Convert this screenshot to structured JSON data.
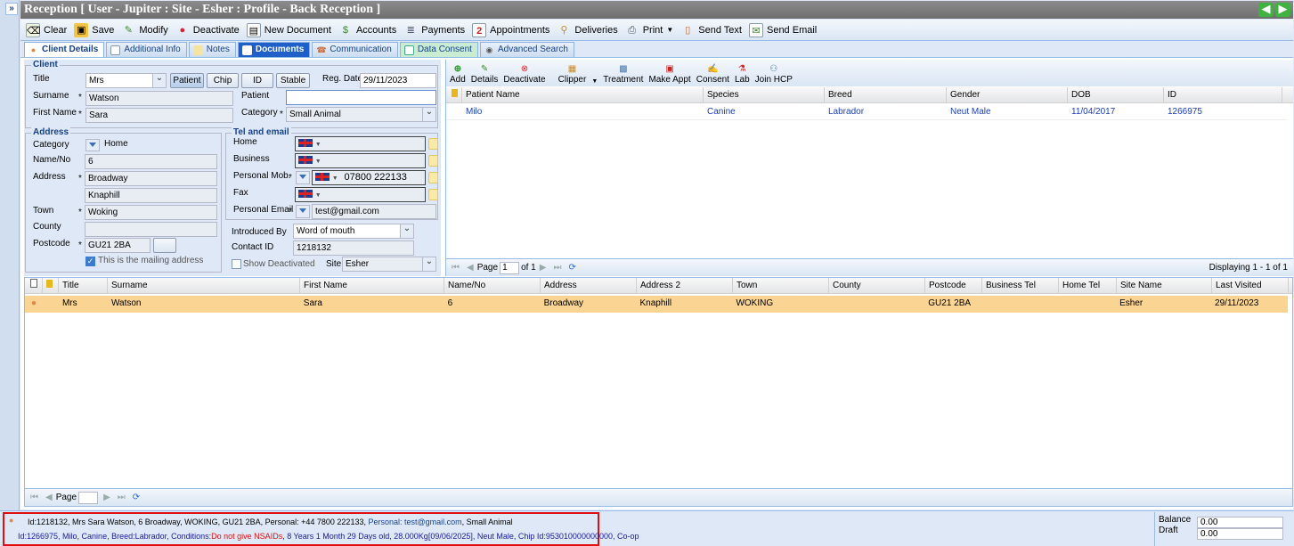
{
  "window": {
    "title": "Reception [ User - Jupiter : Site - Esher : Profile - Back Reception ]",
    "nav_back_icon": "green-left-arrow-icon",
    "nav_forward_icon": "green-right-arrow-icon",
    "expand_label": "»"
  },
  "toolbar": {
    "clear": "Clear",
    "save": "Save",
    "modify": "Modify",
    "deactivate": "Deactivate",
    "new_document": "New Document",
    "accounts": "Accounts",
    "payments": "Payments",
    "appointments": "Appointments",
    "deliveries": "Deliveries",
    "print": "Print",
    "send_text": "Send Text",
    "send_email": "Send Email"
  },
  "tabs": [
    {
      "label": "Client Details",
      "active": true
    },
    {
      "label": "Additional Info",
      "active": false
    },
    {
      "label": "Notes",
      "active": false
    },
    {
      "label": "Documents",
      "active": false
    },
    {
      "label": "Communication",
      "active": false
    },
    {
      "label": "Data Consent",
      "active": false
    },
    {
      "label": "Advanced Search",
      "active": false
    }
  ],
  "client": {
    "legend": "Client",
    "title_label": "Title",
    "title_value": "Mrs",
    "btn_patient": "Patient",
    "btn_chip": "Chip",
    "btn_id": "ID",
    "btn_stable": "Stable",
    "reg_date_label": "Reg. Date",
    "reg_date_value": "29/11/2023",
    "surname_label": "Surname",
    "surname_value": "Watson",
    "patient_label": "Patient",
    "patient_value": "",
    "first_name_label": "First Name",
    "first_name_value": "Sara",
    "category_label": "Category",
    "category_value": "Small Animal",
    "required_mark": "*"
  },
  "address": {
    "legend": "Address",
    "category_label": "Category",
    "category_value": "Home",
    "name_no_label": "Name/No",
    "name_no_value": "6",
    "address_label": "Address",
    "address_line1": "Broadway",
    "address_line2": "Knaphill",
    "town_label": "Town",
    "town_value": "Woking",
    "county_label": "County",
    "county_value": "",
    "postcode_label": "Postcode",
    "postcode_value": "GU21 2BA",
    "mailing_label": "This is the mailing address",
    "mailing_checked": true
  },
  "tel": {
    "legend": "Tel and email",
    "home_label": "Home",
    "business_label": "Business",
    "mobile_label": "Personal Mob.",
    "mobile_value": "07800 222133",
    "fax_label": "Fax",
    "email_label": "Personal Email",
    "email_value": "test@gmail.com"
  },
  "misc": {
    "introduced_by_label": "Introduced By",
    "introduced_by_value": "Word of mouth",
    "contact_id_label": "Contact ID",
    "contact_id_value": "1218132",
    "show_deactivated_label": "Show Deactivated",
    "site_label": "Site",
    "site_value": "Esher"
  },
  "patient_toolbar": {
    "add": "Add",
    "details": "Details",
    "deactivate": "Deactivate",
    "clipper": "Clipper",
    "treatment": "Treatment",
    "make_appt": "Make Appt",
    "consent": "Consent",
    "lab": "Lab",
    "join_hcp": "Join HCP"
  },
  "patient_grid": {
    "columns": [
      "Patient Name",
      "Species",
      "Breed",
      "Gender",
      "DOB",
      "ID"
    ],
    "rows": [
      [
        "Milo",
        "Canine",
        "Labrador",
        "Neut Male",
        "11/04/2017",
        "1266975"
      ]
    ],
    "pager_page_label": "Page",
    "pager_page_value": "1",
    "pager_of": "of 1",
    "displaying": "Displaying 1 - 1 of 1"
  },
  "client_grid": {
    "columns": [
      "Title",
      "Surname",
      "First Name",
      "Name/No",
      "Address",
      "Address 2",
      "Town",
      "County",
      "Postcode",
      "Business Tel",
      "Home Tel",
      "Site Name",
      "Last Visited"
    ],
    "rows": [
      [
        "Mrs",
        "Watson",
        "Sara",
        "6",
        "Broadway",
        "Knaphill",
        "WOKING",
        "",
        "GU21 2BA",
        "",
        "",
        "Esher",
        "29/11/2023"
      ]
    ],
    "pager_page_label": "Page",
    "pager_page_value": ""
  },
  "status": {
    "line1_prefix": "Id:1218132, Mrs Sara Watson, 6 Broadway, WOKING, GU21 2BA, Personal: +44 7800 222133, ",
    "line1_email": "Personal: test@gmail.com",
    "line1_suffix": ", Small Animal",
    "line2_prefix": "Id:1266975, Milo, Canine, Breed:Labrador, Conditions:",
    "line2_warning": "Do not give NSAIDs",
    "line2_suffix": ", 8 Years 1 Month 29 Days old, 28.000Kg[09/06/2025], Neut Male, Chip Id:953010000000000, Co-op",
    "balance_label": "Balance",
    "balance_value": "0.00",
    "draft_label": "Draft",
    "draft_value": "0.00"
  },
  "colors": {
    "title_bar": "#7a7a7a",
    "accent_blue": "#15428b",
    "selected_row": "#f9d493",
    "warning_red": "#e01010",
    "highlight_border": "#e01010"
  }
}
